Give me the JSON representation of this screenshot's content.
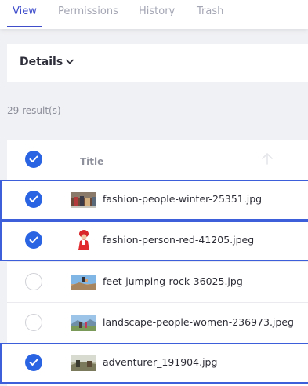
{
  "tabs": [
    {
      "label": "View",
      "active": true
    },
    {
      "label": "Permissions",
      "active": false
    },
    {
      "label": "History",
      "active": false
    },
    {
      "label": "Trash",
      "active": false
    }
  ],
  "details": {
    "label": "Details"
  },
  "results": {
    "count_text": "29 result(s)"
  },
  "table": {
    "header_title": "Title",
    "rows": [
      {
        "filename": "fashion-people-winter-25351.jpg",
        "selected": true,
        "thumb": "winter-people-photo"
      },
      {
        "filename": "fashion-person-red-41205.jpeg",
        "selected": true,
        "thumb": "red-person-photo"
      },
      {
        "filename": "feet-jumping-rock-36025.jpg",
        "selected": false,
        "thumb": "jumping-rock-photo"
      },
      {
        "filename": "landscape-people-women-236973.jpeg",
        "selected": false,
        "thumb": "landscape-women-photo"
      },
      {
        "filename": "adventurer_191904.jpg",
        "selected": true,
        "thumb": "adventurer-photo"
      }
    ]
  },
  "colors": {
    "accent": "#3f4dcb",
    "checkbox": "#2b64e3",
    "selected_border": "#3d5fd9"
  }
}
